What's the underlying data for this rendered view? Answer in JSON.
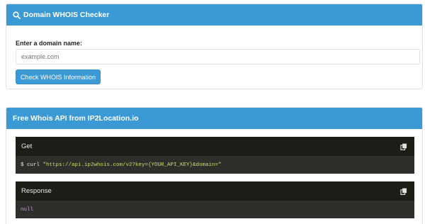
{
  "checker": {
    "title": "Domain WHOIS Checker",
    "icon": "search-icon",
    "input_label": "Enter a domain name:",
    "input_placeholder": "example.com",
    "button_label": "Check WHOIS Information"
  },
  "api": {
    "title": "Free Whois API from IP2Location.io",
    "get": {
      "title": "Get",
      "prompt": "$ curl ",
      "command": "\"https://api.ip2whois.com/v2?key={YOUR_API_KEY}&domain=\""
    },
    "response": {
      "title": "Response",
      "body": "null"
    },
    "copy_icon": "copy-icon"
  },
  "colors": {
    "accent": "#3b99d6",
    "code_header": "#1d1d18",
    "code_body": "#2e2e2a"
  }
}
